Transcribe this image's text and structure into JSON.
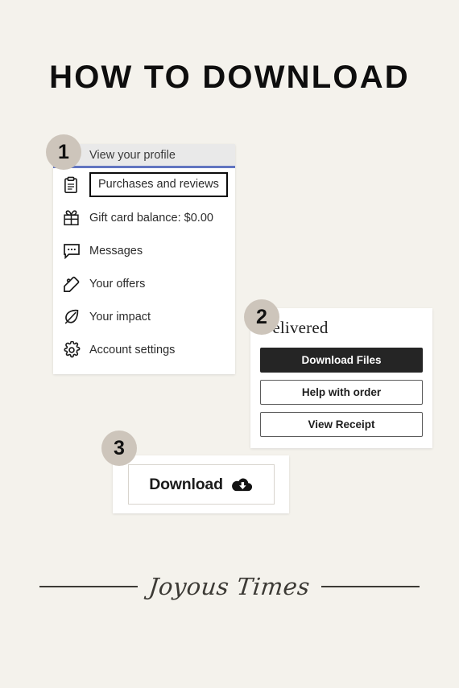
{
  "page": {
    "title": "HOW TO DOWNLOAD",
    "background_color": "#f4f2ec",
    "badge_color": "#cdc5bb",
    "accent_underline_color": "#6275c1",
    "primary_button_color": "#252525"
  },
  "steps": [
    {
      "number": "1"
    },
    {
      "number": "2"
    },
    {
      "number": "3"
    }
  ],
  "step1_menu": {
    "profile_row": {
      "label": "View your profile"
    },
    "items": [
      {
        "label": "Purchases and reviews",
        "icon": "clipboard-icon",
        "highlighted": true
      },
      {
        "label": "Gift card balance: $0.00",
        "icon": "gift-icon",
        "highlighted": false
      },
      {
        "label": "Messages",
        "icon": "message-bubble-icon",
        "highlighted": false
      },
      {
        "label": "Your offers",
        "icon": "price-tag-icon",
        "highlighted": false
      },
      {
        "label": "Your impact",
        "icon": "leaf-icon",
        "highlighted": false
      },
      {
        "label": "Account settings",
        "icon": "gear-icon",
        "highlighted": false
      }
    ]
  },
  "step2_order": {
    "status": "Delivered",
    "buttons": [
      {
        "label": "Download Files",
        "style": "primary"
      },
      {
        "label": "Help with order",
        "style": "secondary"
      },
      {
        "label": "View Receipt",
        "style": "secondary"
      }
    ]
  },
  "step3_download": {
    "button_label": "Download",
    "button_icon": "cloud-download-icon"
  },
  "footer": {
    "brand": "Joyous Times"
  }
}
